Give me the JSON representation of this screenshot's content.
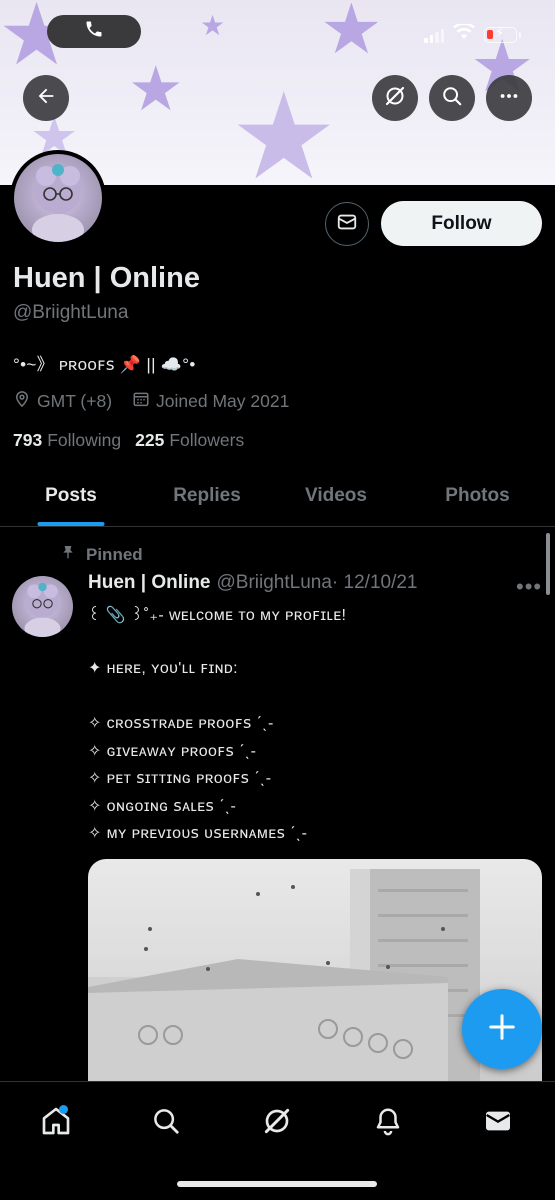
{
  "status_bar": {
    "call_icon": "phone-icon",
    "signal": "cellular-signal-icon",
    "wifi": "wifi-icon",
    "battery": "battery-charging-low-icon"
  },
  "header": {
    "back_icon": "arrow-left-icon",
    "grok_icon": "grok-icon",
    "search_icon": "search-icon",
    "more_icon": "more-horizontal-icon"
  },
  "profile": {
    "display_name": "Huen | Online",
    "handle": "@BriightLuna",
    "bio": "°•~》 ᴘʀᴏᴏꜰꜱ 📌 || ☁️°•",
    "location": "GMT (+8)",
    "joined": "Joined May 2021",
    "following_count": "793",
    "following_label": "Following",
    "followers_count": "225",
    "followers_label": "Followers",
    "follow_label": "Follow"
  },
  "tabs": [
    {
      "label": "Posts",
      "active": true
    },
    {
      "label": "Replies",
      "active": false
    },
    {
      "label": "Videos",
      "active": false
    },
    {
      "label": "Photos",
      "active": false
    }
  ],
  "pinned_tweet": {
    "pinned_label": "Pinned",
    "name": "Huen | Online",
    "handle": "@BriightLuna",
    "date": "· 12/10/21",
    "lines": [
      "꒰ 📎 ꒱˚₊- ᴡᴇʟᴄᴏᴍᴇ ᴛᴏ ᴍʏ ᴘʀᴏꜰɪʟᴇ!",
      "✦ ʜᴇʀᴇ, ʏᴏᴜ'ʟʟ ꜰɪɴᴅ:",
      "✧ ᴄʀᴏꜱꜱᴛʀᴀᴅᴇ ᴘʀᴏᴏꜰꜱ ˊˎ-",
      "✧ ɢɪᴠᴇᴀᴡᴀʏ ᴘʀᴏᴏꜰꜱ ˊˎ-",
      "✧ ᴘᴇᴛ ꜱɪᴛᴛɪɴɢ ᴘʀᴏᴏꜰꜱ ˊˎ-",
      "✧ ᴏɴɢᴏɪɴɢ ꜱᴀʟᴇꜱ ˊˎ-",
      "✧ ᴍʏ ᴘʀᴇᴠɪᴏᴜꜱ ᴜꜱᴇʀɴᴀᴍᴇꜱ ˊˎ-"
    ]
  },
  "fab": {
    "icon": "plus-icon"
  },
  "bottom_nav": [
    {
      "icon": "home-icon",
      "active": true,
      "notification_dot": true
    },
    {
      "icon": "search-icon",
      "active": false
    },
    {
      "icon": "grok-icon",
      "active": false
    },
    {
      "icon": "bell-icon",
      "active": false
    },
    {
      "icon": "mail-icon",
      "active": false
    }
  ],
  "colors": {
    "accent": "#1d9bf0",
    "background": "#000000",
    "text_primary": "#e7e9ea",
    "text_secondary": "#71767b",
    "border": "#2f3336"
  }
}
